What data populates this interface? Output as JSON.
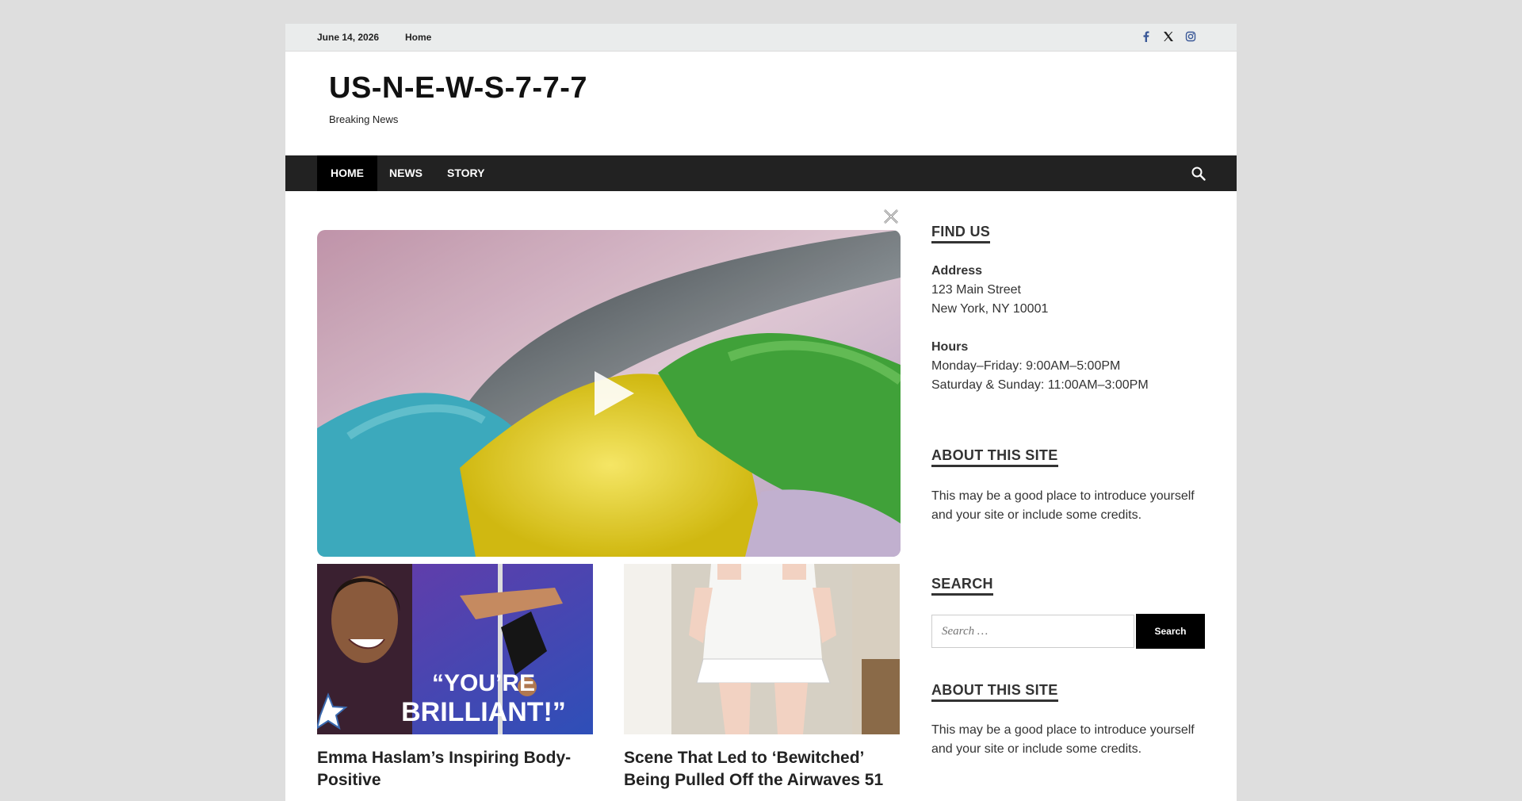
{
  "topbar": {
    "date": "June 14, 2026",
    "home_link": "Home",
    "social_icons": [
      "facebook-icon",
      "x-icon",
      "instagram-icon"
    ]
  },
  "header": {
    "site_title": "US-N-E-W-S-7-7-7",
    "tagline": "Breaking News"
  },
  "nav": {
    "items": [
      {
        "label": "HOME",
        "active": true
      },
      {
        "label": "NEWS",
        "active": false
      },
      {
        "label": "STORY",
        "active": false
      }
    ],
    "search_icon": "search-icon"
  },
  "main": {
    "video": {
      "play_icon": "play-icon",
      "close_icon": "close-icon"
    },
    "posts": [
      {
        "title": "Emma Haslam’s Inspiring Body-Positive",
        "thumb_caption": "“YOU’RE BRILLIANT!”"
      },
      {
        "title": "Scene That Led to ‘Bewitched’ Being Pulled Off the Airwaves 51"
      }
    ]
  },
  "sidebar": {
    "find_us": {
      "title": "FIND US",
      "address_label": "Address",
      "address_line1": "123 Main Street",
      "address_line2": "New York, NY 10001",
      "hours_label": "Hours",
      "hours_line1": "Monday–Friday: 9:00AM–5:00PM",
      "hours_line2": "Saturday & Sunday: 11:00AM–3:00PM"
    },
    "about1": {
      "title": "ABOUT THIS SITE",
      "text": "This may be a good place to introduce yourself and your site or include some credits."
    },
    "search": {
      "title": "SEARCH",
      "placeholder": "Search …",
      "button_label": "Search"
    },
    "about2": {
      "title": "ABOUT THIS SITE",
      "text": "This may be a good place to introduce yourself and your site or include some credits."
    }
  },
  "colors": {
    "page_bg": "#dedede",
    "nav_bg": "#222222",
    "nav_active": "#000000",
    "topbar_bg": "#eaecec"
  }
}
